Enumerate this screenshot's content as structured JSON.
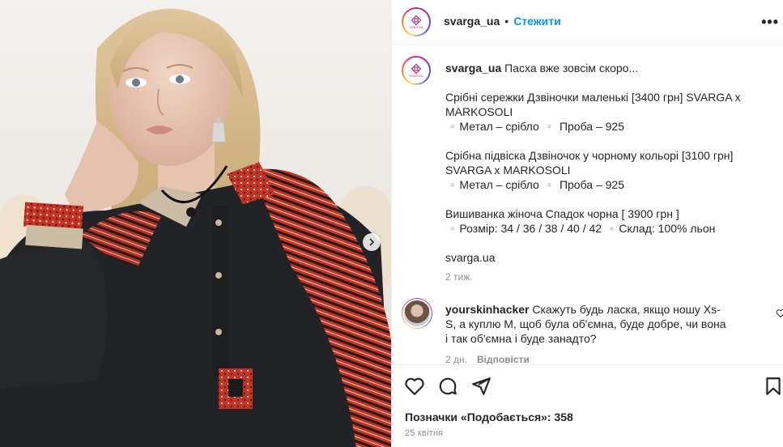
{
  "post": {
    "username": "svarga_ua",
    "follow_label": "Стежити",
    "separator": "•",
    "more_label": "•••",
    "avatar_logo_text": "SVARGA"
  },
  "caption": {
    "username": "svarga_ua",
    "lead": "Пасха вже зовсім скоро...",
    "paragraphs": [
      "Срібні сережки Дзвіночки маленькі [3400 грн] SVARGA x MARKOSOLI\n▫️Метал – срібло ▫️ Проба – 925",
      "Срібна підвіска Дзвіночок у чорному кольорі [3100 грн] SVARGA x MARKOSOLI\n▫️Метал – срібло ▫️ Проба – 925",
      "Вишиванка жіноча Спадок чорна [ 3900 грн ]\n▫️Розмір: 34 / 36 / 38 / 40 / 42 ▫️Склад: 100% льон",
      "svarga.ua"
    ],
    "time": "2 тиж."
  },
  "comment": {
    "username": "yourskinhacker",
    "text": "Скажуть будь ласка, якщо ношу Xs-S, а куплю М, щоб була об'ємна, буде добре, чи вона і так об'ємна і буде занадто?",
    "time": "2 дн.",
    "reply_label": "Відповісти"
  },
  "footer": {
    "likes_label": "Позначки «Подобається»: 358",
    "date": "25 квітня"
  },
  "colors": {
    "accent": "#0095f6",
    "text": "#262626",
    "muted": "#8e8e8e",
    "shirt": "#222326",
    "embroidery_red": "#c8301f"
  },
  "icons": {
    "like": "heart-icon",
    "comment": "comment-icon",
    "share": "send-icon",
    "save": "bookmark-icon",
    "more": "more-dots-icon",
    "carousel_next": "chevron-right-icon"
  }
}
